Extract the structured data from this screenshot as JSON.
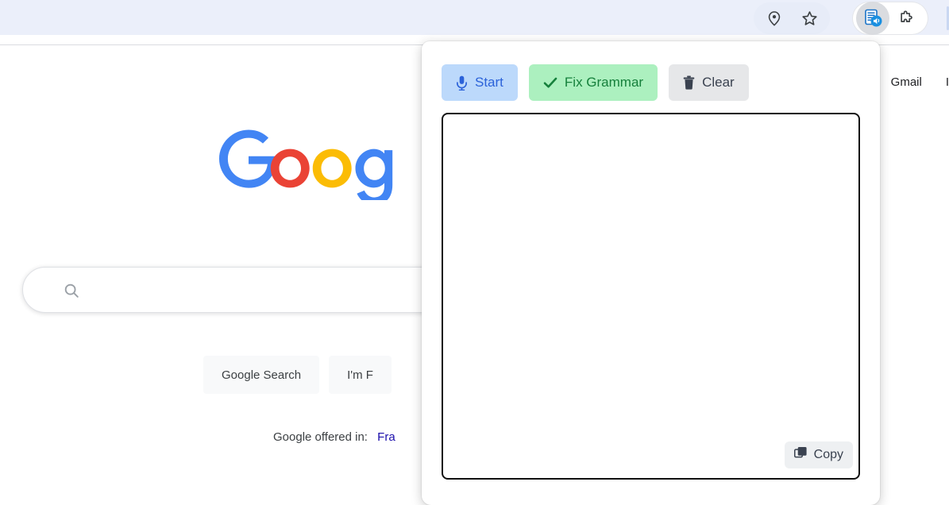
{
  "browser": {
    "toolbar_icons": [
      {
        "name": "location-pin-icon",
        "label": "Location"
      },
      {
        "name": "bookmark-star-icon",
        "label": "Bookmark this tab"
      },
      {
        "name": "speech-extension-icon",
        "label": "Speech Notes Extension"
      },
      {
        "name": "puzzle-extensions-icon",
        "label": "Extensions"
      }
    ]
  },
  "page": {
    "links": [
      {
        "label": "Gmail",
        "name": "gmail-link"
      },
      {
        "label": "I",
        "name": "images-link"
      }
    ],
    "logo_alt": "Google",
    "search": {
      "value": "",
      "placeholder": ""
    },
    "buttons": [
      {
        "label": "Google Search",
        "name": "google-search-button"
      },
      {
        "label": "I'm F",
        "name": "im-feeling-lucky-button"
      }
    ],
    "offered_in_label": "Google offered in:",
    "offered_in_language": "Fra"
  },
  "popup": {
    "buttons": [
      {
        "label": "Start",
        "icon": "microphone-icon",
        "name": "start-button"
      },
      {
        "label": "Fix Grammar",
        "icon": "checkmark-icon",
        "name": "fix-grammar-button"
      },
      {
        "label": "Clear",
        "icon": "trash-icon",
        "name": "clear-button"
      }
    ],
    "textarea": {
      "value": "",
      "placeholder": ""
    },
    "copy_label": "Copy"
  },
  "colors": {
    "toolbar_bg": "#ebeffa",
    "start_bg": "#bcd9fb",
    "start_fg": "#2b62d9",
    "fix_bg": "#acf0bf",
    "fix_fg": "#16803c",
    "clear_bg": "#e6e7e9",
    "clear_fg": "#3a4250",
    "textarea_border": "#111111",
    "link_blue": "#1a0dab",
    "google_blue": "#4285f4",
    "google_red": "#ea4335",
    "google_yellow": "#fbbc05",
    "google_green": "#34a853"
  }
}
